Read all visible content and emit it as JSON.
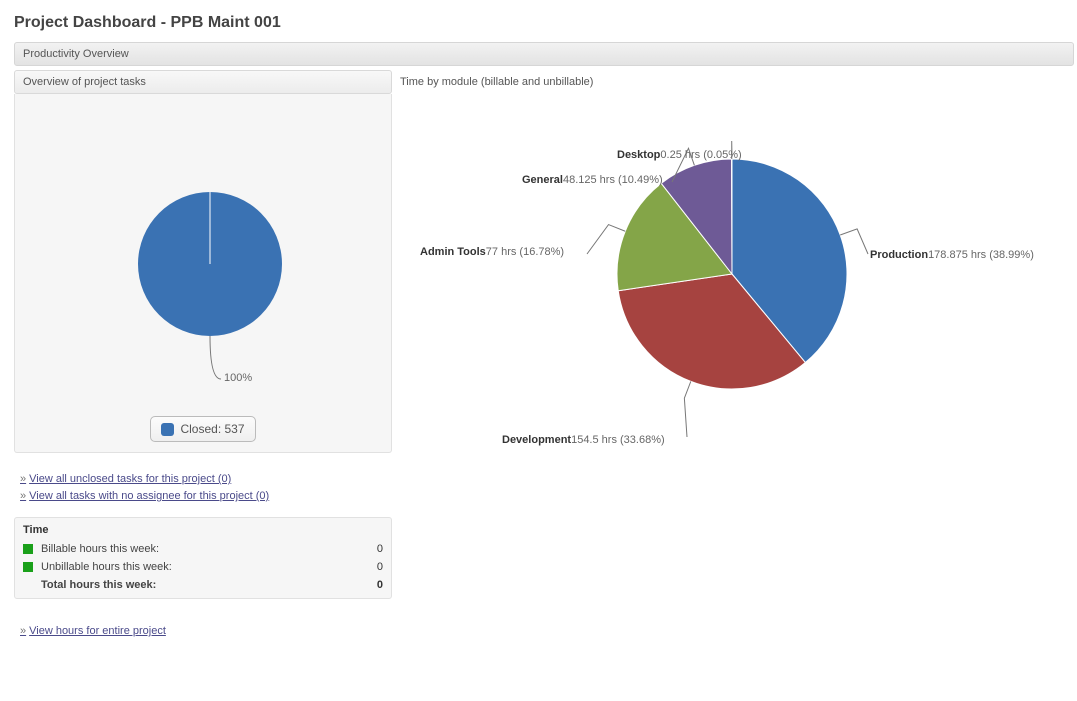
{
  "title": "Project Dashboard - PPB Maint 001",
  "section": {
    "title": "Productivity Overview"
  },
  "left": {
    "panel_title": "Overview of project tasks",
    "pie_pct_label": "100%",
    "legend_label": "Closed: 537",
    "link1": "View all unclosed tasks for this project (0)",
    "link2": "View all tasks with no assignee for this project (0)",
    "time_heading": "Time",
    "billable_label": "Billable hours this week:",
    "billable_value": "0",
    "unbillable_label": "Unbillable hours this week:",
    "unbillable_value": "0",
    "total_label": "Total hours this week:",
    "total_value": "0",
    "view_hours_link": "View hours for entire project"
  },
  "right": {
    "panel_title": "Time by module (billable and unbillable)",
    "slices": {
      "production": {
        "name": "Production",
        "value": "178.875 hrs (38.99%)"
      },
      "development": {
        "name": "Development",
        "value": "154.5 hrs (33.68%)"
      },
      "admin": {
        "name": "Admin Tools",
        "value": "77 hrs (16.78%)"
      },
      "general": {
        "name": "General",
        "value": "48.125 hrs (10.49%)"
      },
      "desktop": {
        "name": "Desktop",
        "value": "0.25 hrs (0.05%)"
      }
    }
  },
  "chart_data": [
    {
      "type": "pie",
      "title": "Overview of project tasks",
      "series": [
        {
          "name": "Closed",
          "value": 537,
          "pct": 100
        }
      ]
    },
    {
      "type": "pie",
      "title": "Time by module (billable and unbillable)",
      "unit": "hrs",
      "series": [
        {
          "name": "Production",
          "value": 178.875,
          "pct": 38.99,
          "color": "#3a72b3"
        },
        {
          "name": "Development",
          "value": 154.5,
          "pct": 33.68,
          "color": "#a64340"
        },
        {
          "name": "Admin Tools",
          "value": 77,
          "pct": 16.78,
          "color": "#84a548"
        },
        {
          "name": "General",
          "value": 48.125,
          "pct": 10.49,
          "color": "#6e5a96"
        },
        {
          "name": "Desktop",
          "value": 0.25,
          "pct": 0.05,
          "color": "#3e97a8"
        }
      ]
    }
  ]
}
